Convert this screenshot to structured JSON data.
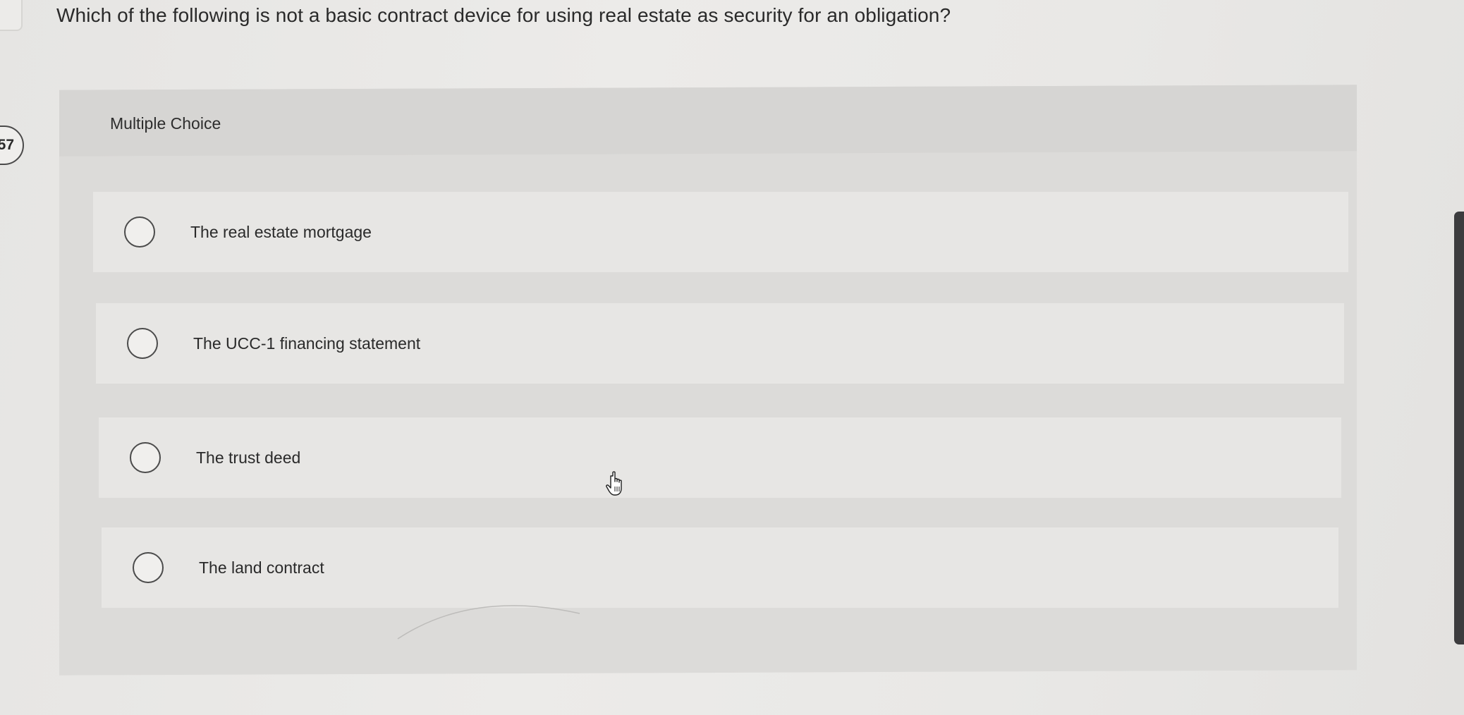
{
  "question": {
    "number_fragment": ":57",
    "text": "Which of the following is not a basic contract device for using real estate as security for an obligation?"
  },
  "panel": {
    "type_label": "Multiple Choice"
  },
  "options": [
    {
      "label": "The real estate mortgage"
    },
    {
      "label": "The UCC-1 financing statement"
    },
    {
      "label": "The trust deed"
    },
    {
      "label": "The land contract"
    }
  ],
  "cursor": {
    "icon": "hand-pointer-icon"
  }
}
